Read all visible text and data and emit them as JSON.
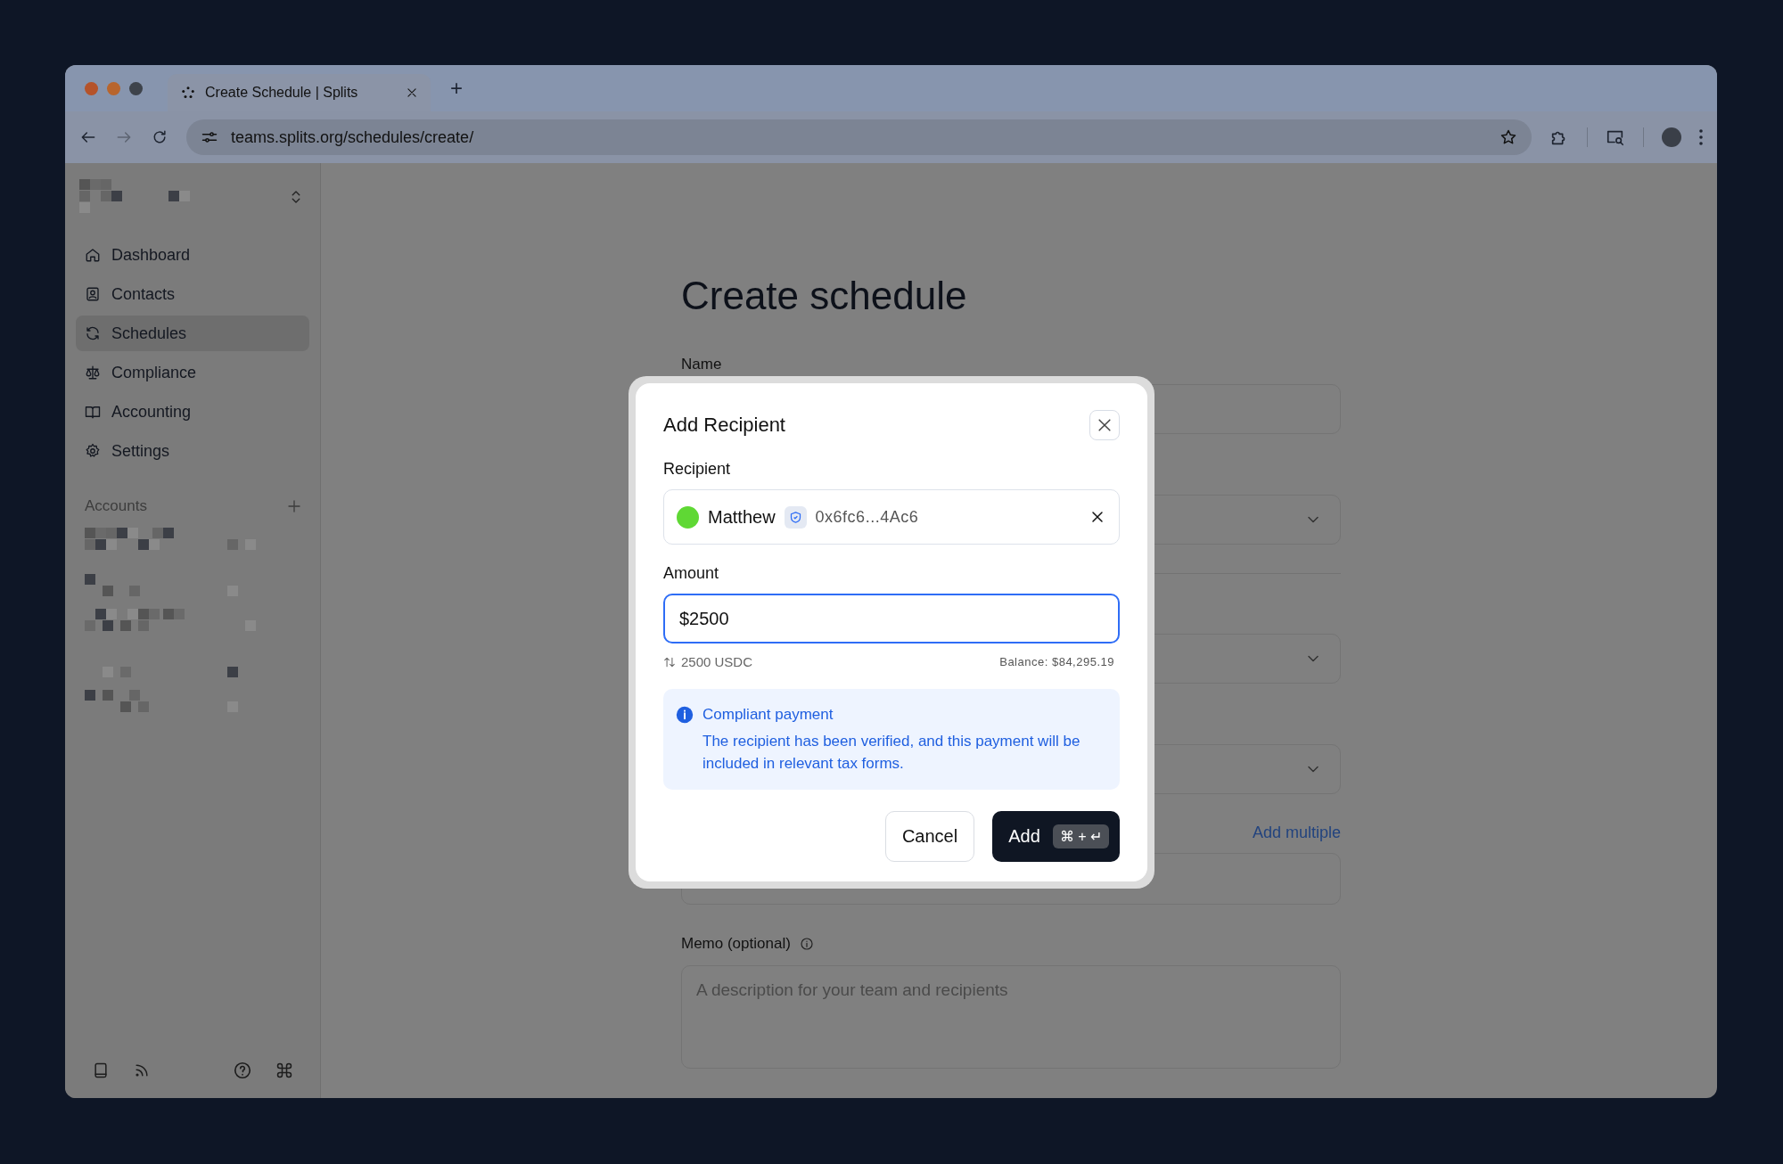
{
  "browser": {
    "tab": {
      "title": "Create Schedule | Splits"
    },
    "new_tab": "+",
    "url": "teams.splits.org/schedules/create/"
  },
  "sidebar": {
    "nav": [
      {
        "label": "Dashboard",
        "selected": false
      },
      {
        "label": "Contacts",
        "selected": false
      },
      {
        "label": "Schedules",
        "selected": true
      },
      {
        "label": "Compliance",
        "selected": false
      },
      {
        "label": "Accounting",
        "selected": false
      },
      {
        "label": "Settings",
        "selected": false
      }
    ],
    "accounts_heading": "Accounts"
  },
  "page": {
    "title": "Create schedule",
    "name_label": "Name",
    "add_multiple": "Add multiple",
    "memo_label": "Memo (optional)",
    "memo_placeholder": "A description for your team and recipients"
  },
  "dialog": {
    "title": "Add Recipient",
    "recipient_label": "Recipient",
    "recipient": {
      "name": "Matthew",
      "color": "#5fd834",
      "verified": true,
      "address": "0x6fc6...4Ac6"
    },
    "amount_label": "Amount",
    "amount": "$2500",
    "conversion": "2500 USDC",
    "balance": "Balance: $84,295.19",
    "notice": {
      "title": "Compliant payment",
      "text": "The recipient has been verified, and this payment will be included in relevant tax forms."
    },
    "buttons": [
      {
        "label": "Cancel",
        "kind": "secondary"
      },
      {
        "label": "Add",
        "kind": "primary",
        "shortcut": "⌘ + ↵"
      }
    ]
  }
}
